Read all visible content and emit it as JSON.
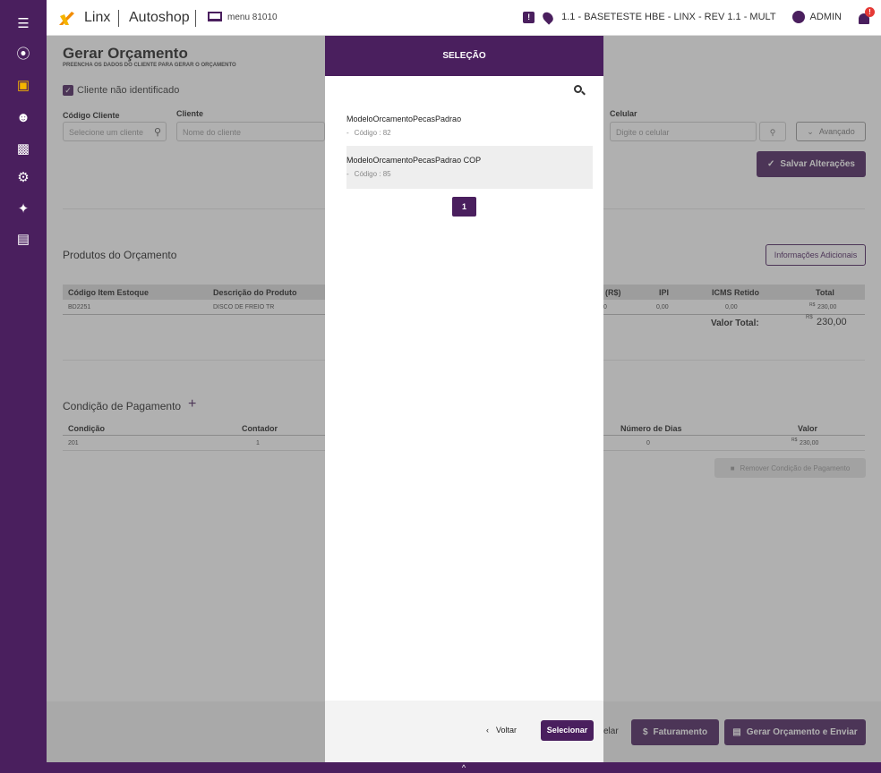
{
  "topbar": {
    "brand": "Linx",
    "product": "Autoshop",
    "menu_label": "menu 81010",
    "company": "1.1 - BASETESTE HBE - LINX - REV 1.1 - MULT",
    "user": "ADMIN",
    "notif_count": "!"
  },
  "page": {
    "title": "Gerar Orçamento",
    "subtitle": "PREENCHA OS DADOS DO CLIENTE PARA GERAR O ORÇAMENTO",
    "unidentified_label": "Cliente não identificado",
    "client_code_label": "Código Cliente",
    "client_code_placeholder": "Selecione um cliente",
    "client_label": "Cliente",
    "client_placeholder": "Nome do cliente",
    "cell_label": "Celular",
    "cell_placeholder": "Digite o celular",
    "advanced": "Avançado",
    "save": "Salvar Alterações",
    "products_title": "Produtos do Orçamento",
    "extra_info": "Informações Adicionais",
    "products_headers": [
      "Código Item Estoque",
      "Descrição do Produto",
      "(R$)",
      "IPI",
      "ICMS Retido",
      "Total"
    ],
    "products_rows": [
      {
        "code": "BD2251",
        "desc": "DISCO DE FREIO TR",
        "price": "0",
        "ipi": "0,00",
        "icms": "0,00",
        "currency": "R$",
        "total": "230,00"
      }
    ],
    "total_label": "Valor Total:",
    "total_currency": "R$",
    "total_value": "230,00",
    "payment_title": "Condição de Pagamento",
    "payment_add": "+",
    "payment_headers": [
      "Condição",
      "Contador",
      "Número de Dias",
      "Valor"
    ],
    "payment_rows": [
      {
        "cond": "201",
        "count": "1",
        "days": "0",
        "currency": "R$",
        "value": "230,00"
      }
    ],
    "remove_payment": "Remover Condição de Pagamento",
    "cancel_fragment": "elar",
    "billing": "Faturamento",
    "generate_send": "Gerar Orçamento e Enviar",
    "bottom_toggle": "^"
  },
  "modal": {
    "title": "SELEÇÃO",
    "items": [
      {
        "name": "ModeloOrcamentoPecasPadrao",
        "code_prefix": "-",
        "code": "Código : 82"
      },
      {
        "name": "ModeloOrcamentoPecasPadrao COP",
        "code_prefix": "-",
        "code": "Código : 85"
      }
    ],
    "page": "1",
    "back": "Voltar",
    "select": "Selecionar"
  },
  "colors": {
    "primary": "#4a1f5e",
    "accent": "#f5b400",
    "alert": "#e53935"
  }
}
